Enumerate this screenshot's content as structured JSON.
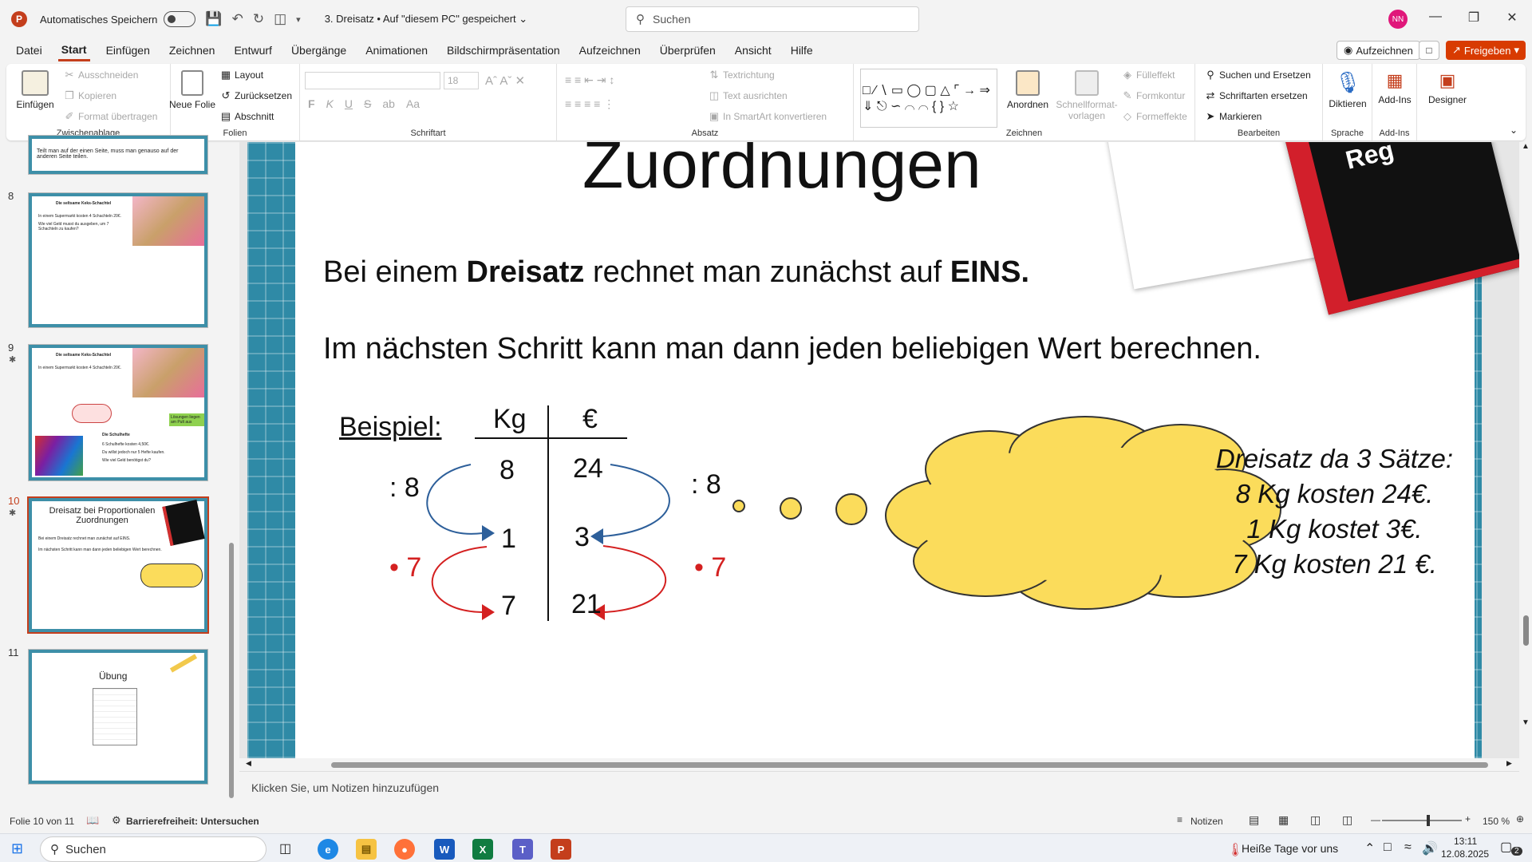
{
  "titlebar": {
    "autosave_label": "Automatisches Speichern",
    "doc_title": "3. Dreisatz • Auf \"diesem PC\" gespeichert ⌄",
    "search_placeholder": "Suchen",
    "avatar": "NN"
  },
  "tabs": [
    "Datei",
    "Start",
    "Einfügen",
    "Zeichnen",
    "Entwurf",
    "Übergänge",
    "Animationen",
    "Bildschirmpräsentation",
    "Aufzeichnen",
    "Überprüfen",
    "Ansicht",
    "Hilfe"
  ],
  "actions": {
    "record": "Aufzeichnen",
    "share": "Freigeben"
  },
  "ribbon": {
    "clipboard": {
      "paste": "Einfügen",
      "cut": "Ausschneiden",
      "copy": "Kopieren",
      "format": "Format übertragen",
      "label": "Zwischenablage"
    },
    "slides": {
      "new": "Neue Folie",
      "layout": "Layout",
      "reset": "Zurücksetzen",
      "section": "Abschnitt",
      "label": "Folien"
    },
    "font": {
      "size": "18",
      "label": "Schriftart"
    },
    "paragraph": {
      "direction": "Textrichtung",
      "align": "Text ausrichten",
      "smartart": "In SmartArt konvertieren",
      "label": "Absatz"
    },
    "drawing": {
      "arrange": "Anordnen",
      "quickstyles": "Schnellformat-vorlagen",
      "fill": "Fülleffekt",
      "outline": "Formkontur",
      "effects": "Formeffekte",
      "label": "Zeichnen"
    },
    "editing": {
      "find": "Suchen und Ersetzen",
      "replace": "Schriftarten ersetzen",
      "select": "Markieren",
      "label": "Bearbeiten"
    },
    "voice": {
      "dictate": "Diktieren",
      "label": "Sprache"
    },
    "addins": {
      "addins": "Add-Ins",
      "label": "Add-Ins"
    },
    "designer": {
      "label": "Designer"
    }
  },
  "thumbnails": [
    {
      "num": "8",
      "title": "Die seltsame Keks-Schachtel",
      "text1": "In einem Supermarkt kosten 4 Schachteln 20€.",
      "text2": "Wie viel Geld musst du ausgeben, um 7 Schachteln zu kaufen?"
    },
    {
      "num": "9",
      "title": "Die seltsame Keks-Schachtel",
      "text1": "In einem Supermarkt kosten 4 Schachteln 20€.",
      "sub": "Die Schulhefte",
      "text2": "6 Schulhefte kosten 4,50€.",
      "text3": "Du willst jedoch nur 5 Hefte kaufen.",
      "text4": "Wie viel Geld benötigst du?",
      "note": "Lösungen liegen am Pult aus"
    },
    {
      "num": "10",
      "title": "Dreisatz bei Proportionalen Zuordnungen",
      "text1": "Bei einem Dreisatz rechnet man zunächst auf EINS.",
      "text2": "Im nächsten Schritt kann man dann jeden beliebigen Wert berechnen."
    },
    {
      "num": "11",
      "title": "Übung"
    }
  ],
  "prev_thumb_text": "Teilt man auf der einen Seite, muss man genauso auf der anderen Seite teilen.",
  "slide": {
    "title": "Zuordnungen",
    "line1_a": "Bei einem ",
    "line1_b": "Dreisatz",
    "line1_c": " rechnet man zunächst auf ",
    "line1_d": "EINS.",
    "line2": "Im nächsten Schritt kann man dann jeden beliebigen Wert berechnen.",
    "example_label": "Beispiel:",
    "table": {
      "col1": "Kg",
      "col2": "€",
      "rows": [
        [
          "8",
          "24"
        ],
        [
          "1",
          "3"
        ],
        [
          "7",
          "21"
        ]
      ]
    },
    "ops": {
      "div_left": ": 8",
      "div_right": ": 8",
      "mul_left": "• 7",
      "mul_right": "• 7"
    },
    "cloud": [
      "Dreisatz da 3 Sätze:",
      "8 Kg kosten 24€.",
      "1 Kg kostet 3€.",
      "7 Kg kosten 21 €."
    ],
    "book_text": "Reg"
  },
  "notes_placeholder": "Klicken Sie, um Notizen hinzuzufügen",
  "status": {
    "slide": "Folie 10 von 11",
    "accessibility": "Barrierefreiheit: Untersuchen",
    "notes": "Notizen",
    "zoom": "150 %"
  },
  "taskbar": {
    "search": "Suchen",
    "weather": "Heiße Tage vor uns",
    "time": "13:11",
    "date": "12.08.2025",
    "badge": "2"
  }
}
